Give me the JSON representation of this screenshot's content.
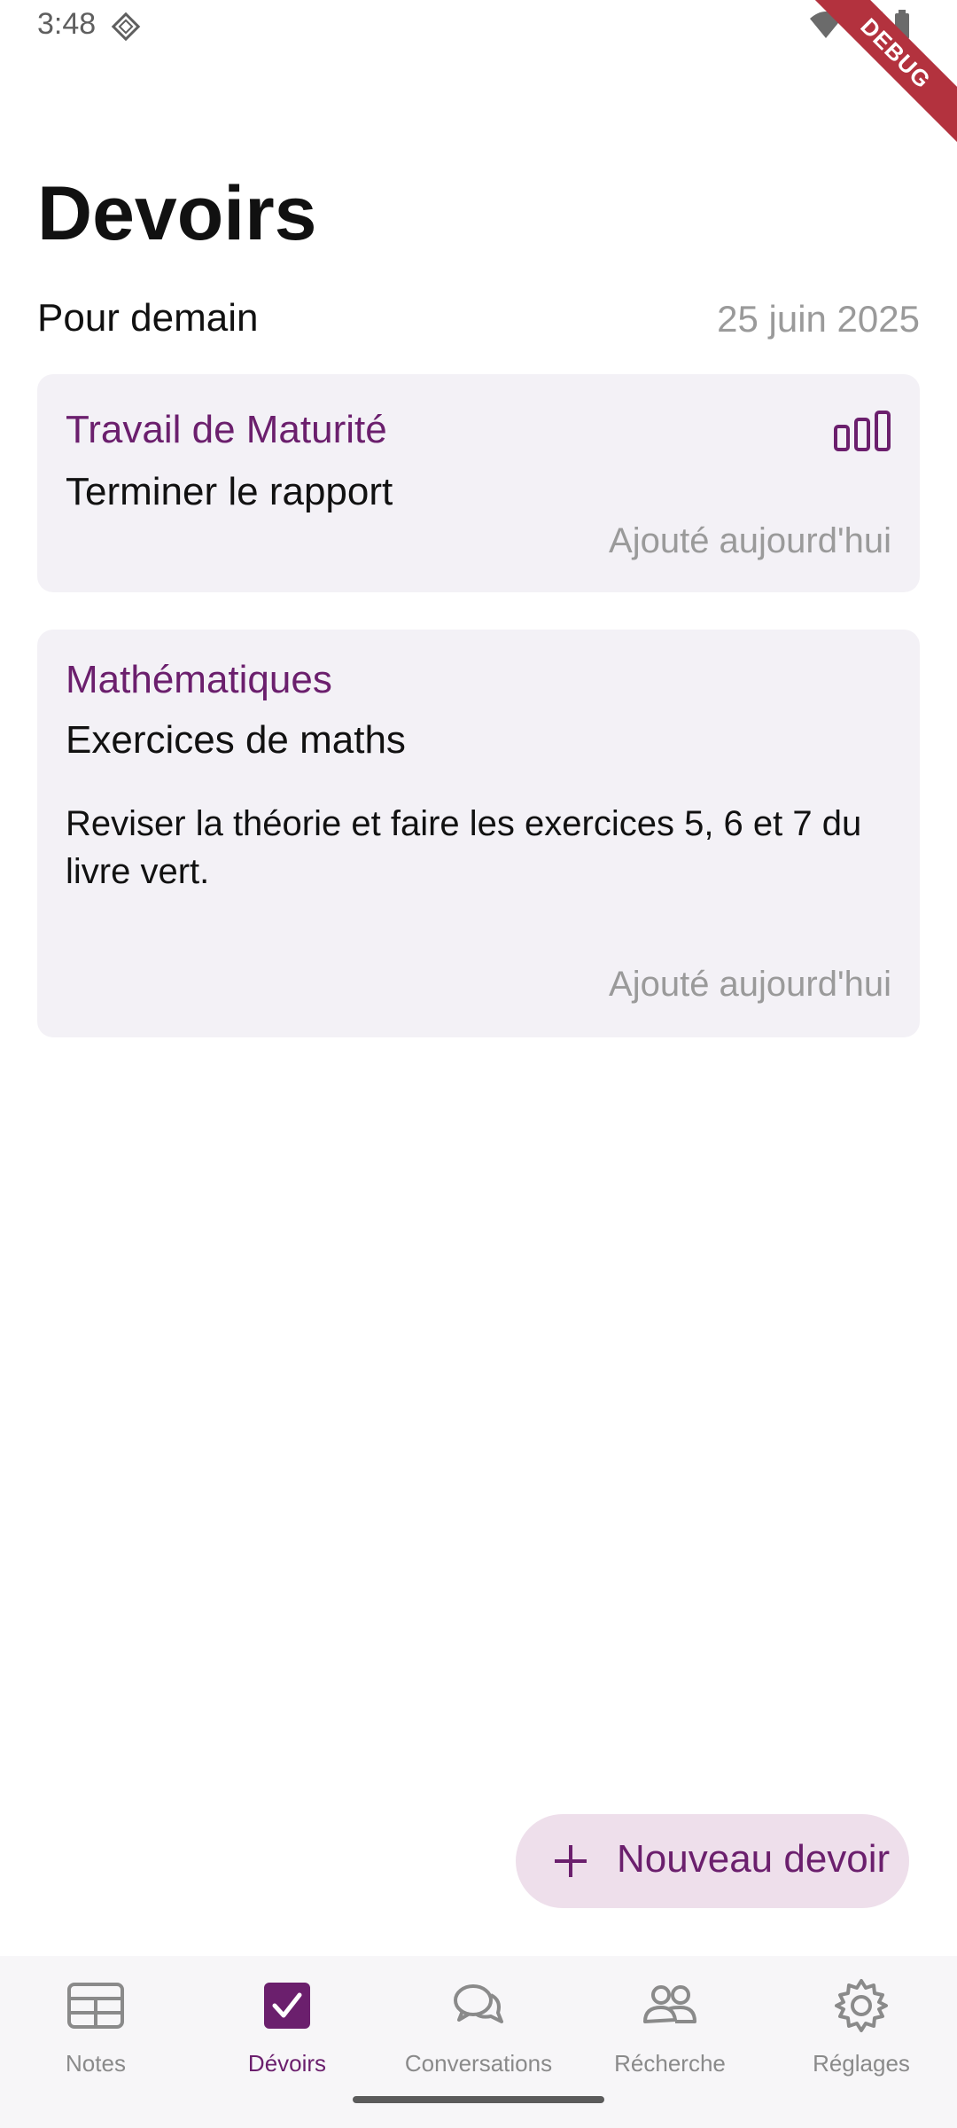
{
  "status_bar": {
    "time": "3:48",
    "debug_banner": "DEBUG",
    "icons": [
      "wifi-icon",
      "cell-signal-icon",
      "battery-icon"
    ]
  },
  "page": {
    "title": "Devoirs"
  },
  "section": {
    "title": "Pour demain",
    "date": "25 juin 2025"
  },
  "tasks": [
    {
      "subject": "Travail de Maturité",
      "title": "Terminer le rapport",
      "description": "",
      "added": "Ajouté aujourd'hui",
      "icon": "progress-bars-icon"
    },
    {
      "subject": "Mathématiques",
      "title": "Exercices de maths",
      "description": "Reviser la théorie et faire les exercices 5, 6 et 7 du livre vert.",
      "added": "Ajouté aujourd'hui"
    }
  ],
  "fab": {
    "label": "Nouveau devoir",
    "icon": "plus-icon"
  },
  "bottom_nav": {
    "items": [
      {
        "label": "Notes",
        "icon": "table-icon",
        "active": false
      },
      {
        "label": "Dévoirs",
        "icon": "checkbox-icon",
        "active": true
      },
      {
        "label": "Conversations",
        "icon": "chat-bubbles-icon",
        "active": false
      },
      {
        "label": "Récherche",
        "icon": "people-icon",
        "active": false
      },
      {
        "label": "Réglages",
        "icon": "gear-icon",
        "active": false
      }
    ]
  },
  "colors": {
    "accent": "#6b1f6d",
    "card_bg": "#f3f1f6",
    "fab_bg": "#eedfeb",
    "muted_text": "#9a9a9a"
  }
}
